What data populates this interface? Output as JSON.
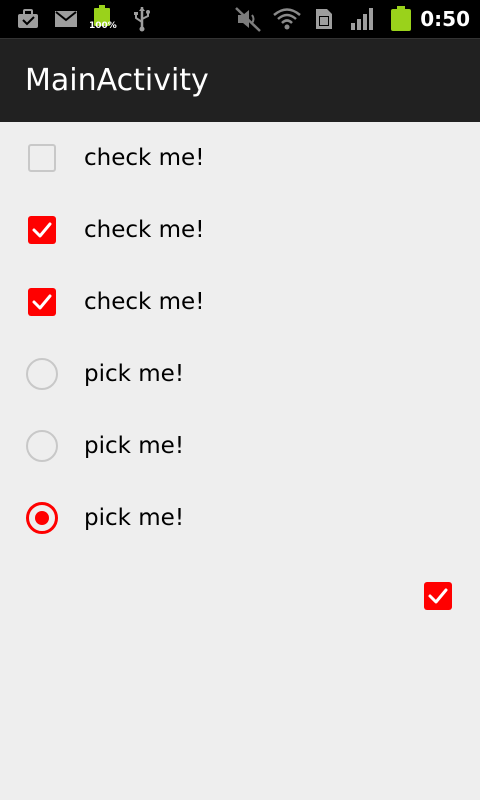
{
  "status_bar": {
    "icons_left": [
      "briefcase-icon",
      "gmail-icon",
      "battery-charging-icon",
      "usb-icon"
    ],
    "battery_percent": "100%",
    "icons_right": [
      "mute-icon",
      "wifi-icon",
      "sim-card-icon",
      "signal-icon",
      "battery-icon"
    ],
    "time": "0:50"
  },
  "action_bar": {
    "title": "MainActivity"
  },
  "list": {
    "checkboxes": [
      {
        "label": "check me!",
        "checked": false
      },
      {
        "label": "check me!",
        "checked": true
      },
      {
        "label": "check me!",
        "checked": true
      }
    ],
    "radios": [
      {
        "label": "pick me!",
        "selected": false
      },
      {
        "label": "pick me!",
        "selected": false
      },
      {
        "label": "pick me!",
        "selected": true
      }
    ]
  },
  "standalone_checkbox": {
    "checked": true
  },
  "colors": {
    "accent": "#ff0000",
    "background": "#eeeeee",
    "action_bar": "#212121",
    "status_bar": "#000000",
    "inactive_control": "#c8c8c8",
    "battery_green": "#9ad21b"
  }
}
